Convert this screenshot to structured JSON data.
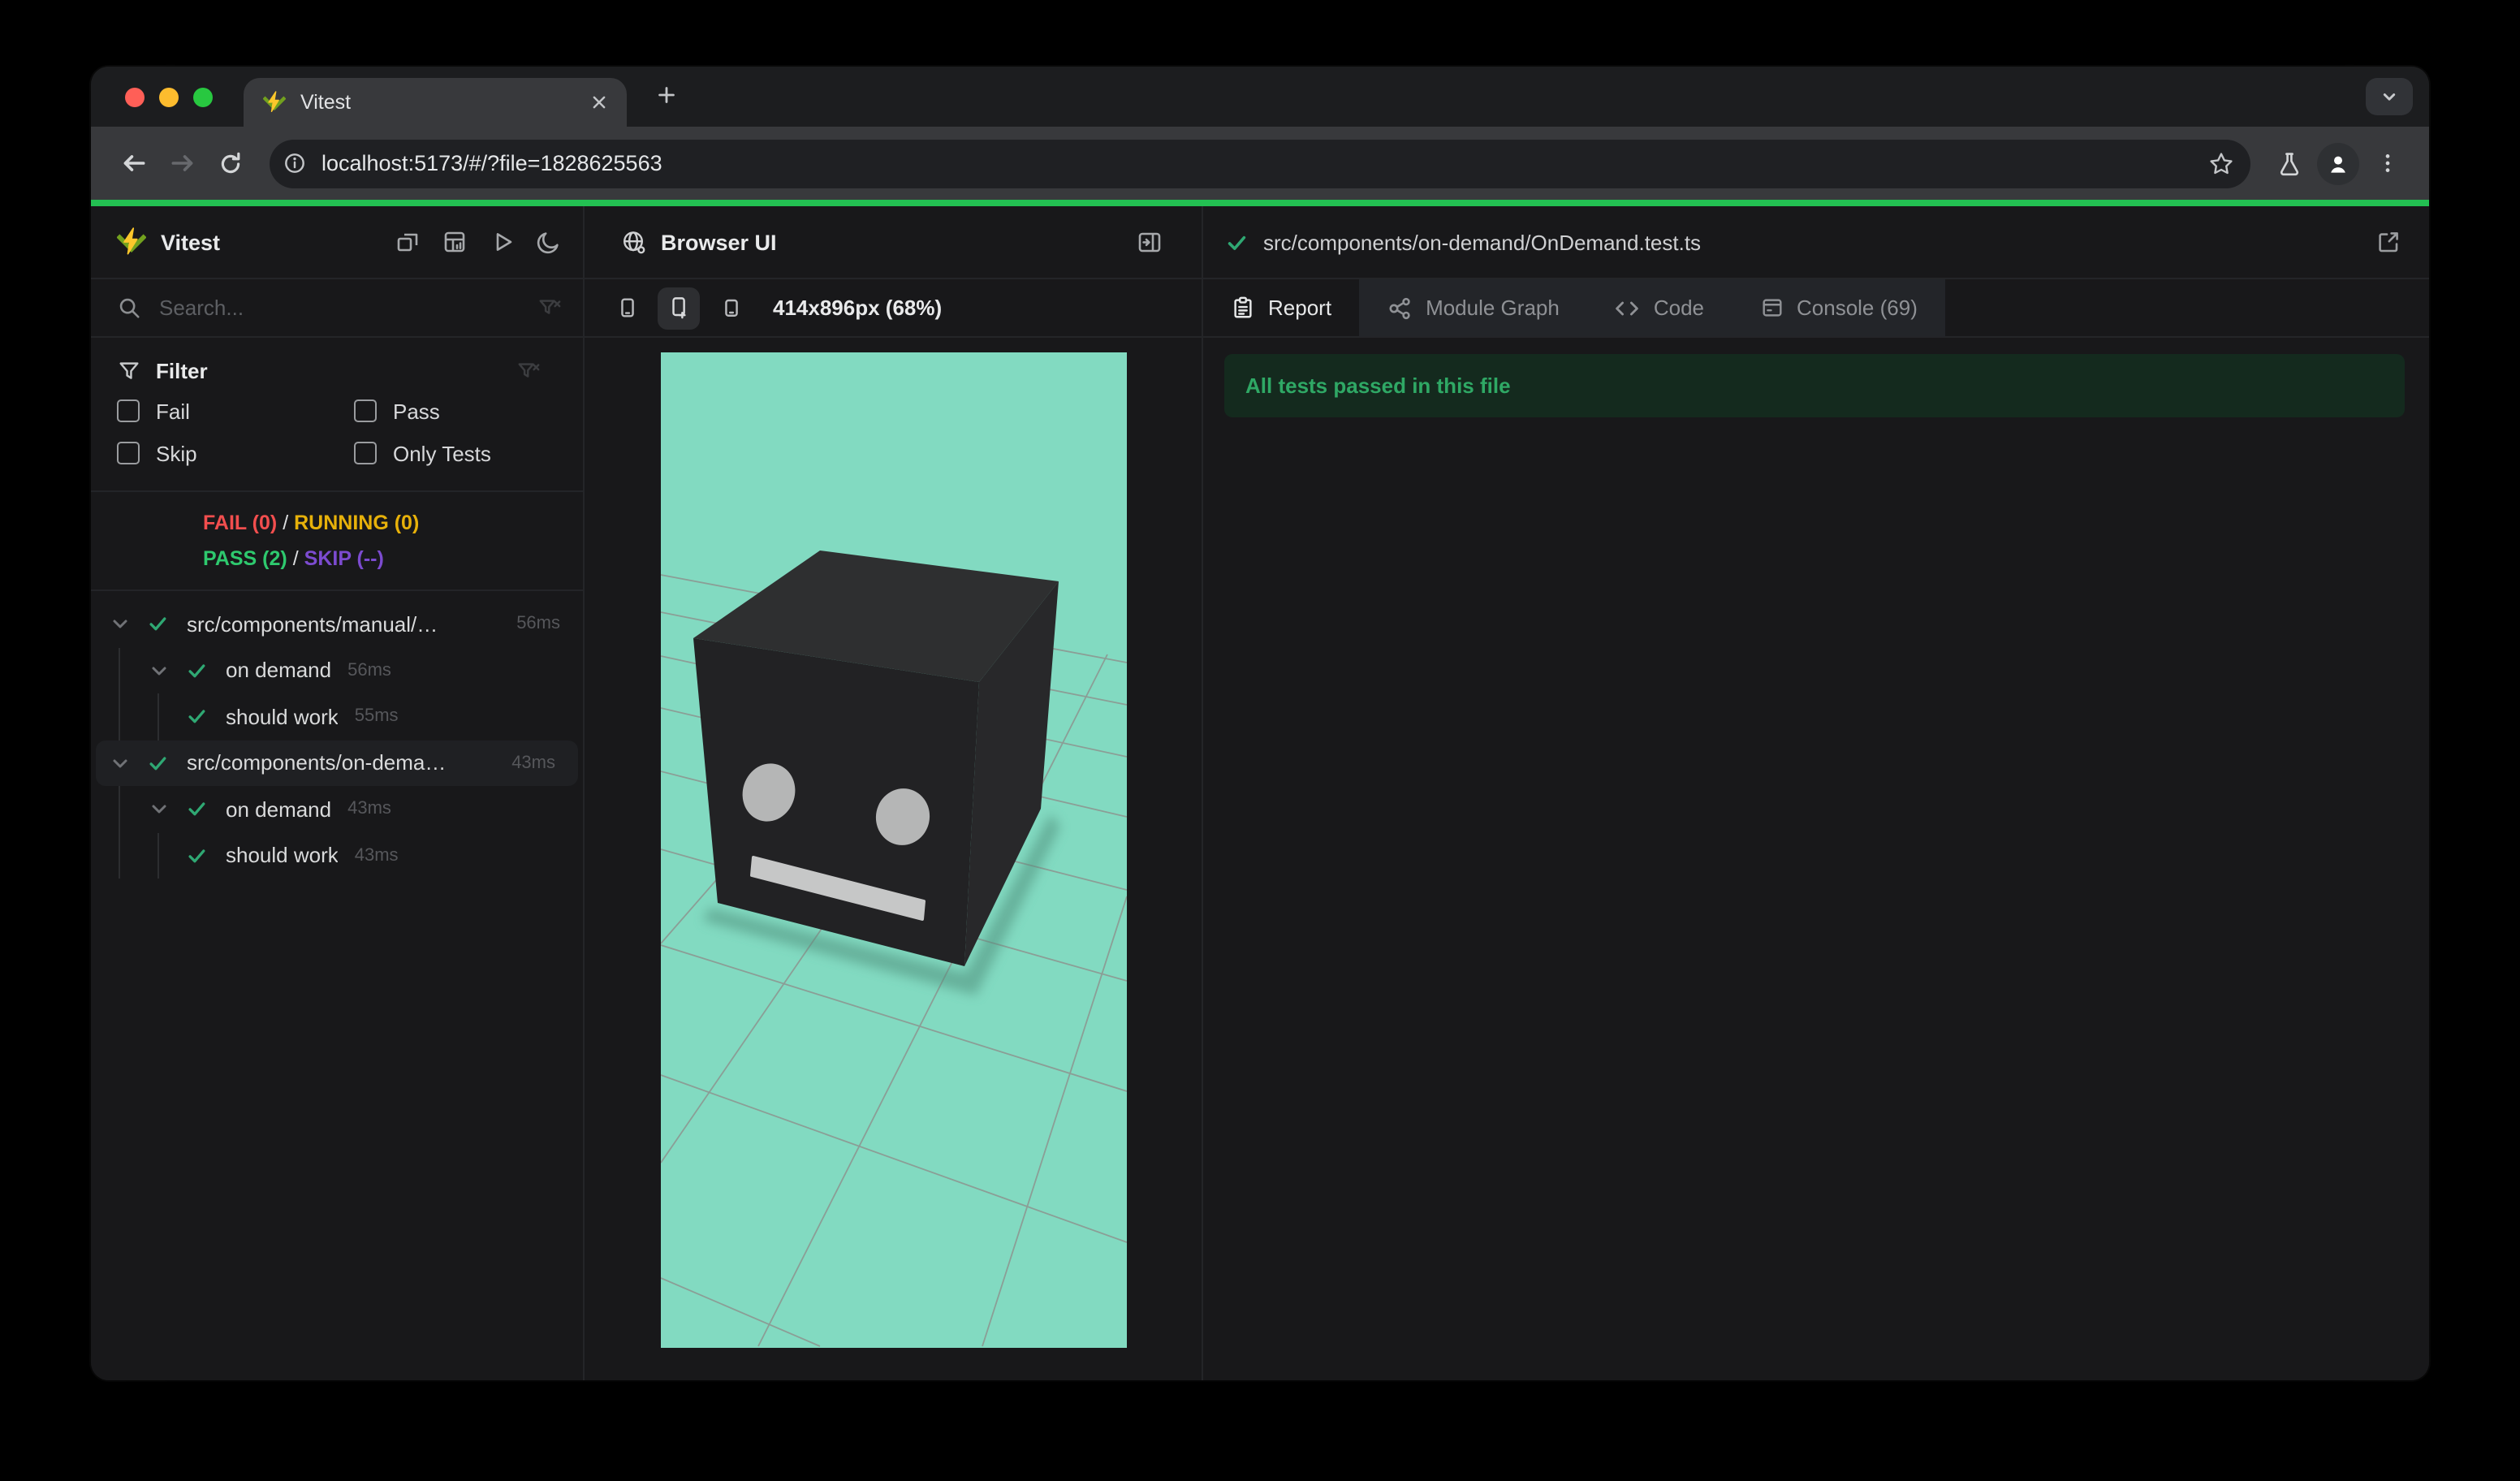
{
  "browser": {
    "tab_title": "Vitest",
    "url": "localhost:5173/#/?file=1828625563"
  },
  "sidebar": {
    "title": "Vitest",
    "search_placeholder": "Search...",
    "filter_title": "Filter",
    "checkboxes": [
      "Fail",
      "Pass",
      "Skip",
      "Only Tests"
    ],
    "stats": {
      "fail": "FAIL (0)",
      "running": "RUNNING (0)",
      "pass": "PASS (2)",
      "skip": "SKIP (--)",
      "sep": "/"
    },
    "tree": [
      {
        "label": "src/components/manual/…",
        "time": "56ms",
        "level": 0
      },
      {
        "label": "on demand",
        "time": "56ms",
        "level": 1
      },
      {
        "label": "should work",
        "time": "55ms",
        "level": 2
      },
      {
        "label": "src/components/on-dema…",
        "time": "43ms",
        "level": 0,
        "selected": true
      },
      {
        "label": "on demand",
        "time": "43ms",
        "level": 1
      },
      {
        "label": "should work",
        "time": "43ms",
        "level": 2
      }
    ]
  },
  "preview": {
    "title": "Browser UI",
    "resolution_label": "414x896px (68%)"
  },
  "report": {
    "file_path": "src/components/on-demand/OnDemand.test.ts",
    "tabs": [
      "Report",
      "Module Graph",
      "Code",
      "Console (69)"
    ],
    "banner": "All tests passed in this file"
  },
  "colors": {
    "accent_green": "#23c052",
    "pass_green": "#2ec96e",
    "fail_red": "#f24e4e",
    "running_yellow": "#e7b10a",
    "skip_purple": "#7c4bd0",
    "viewport_teal": "#82dac1",
    "banner_bg": "#142a1e",
    "logo_green": "#72a11e",
    "logo_yellow": "#fcc72b"
  }
}
